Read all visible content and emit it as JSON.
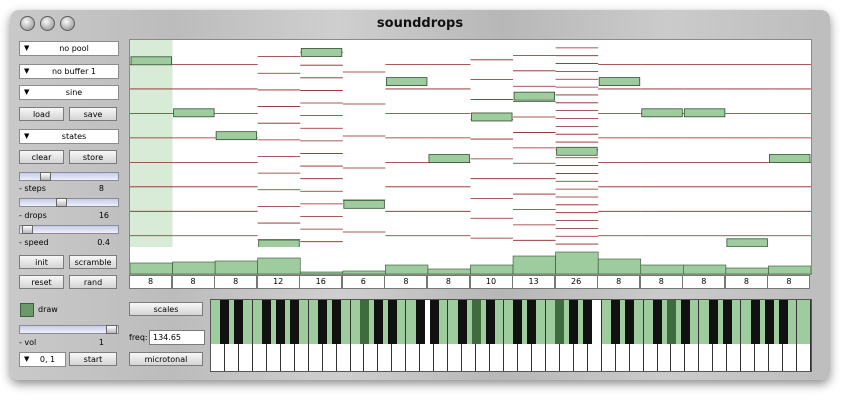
{
  "window": {
    "title": "sounddrops"
  },
  "left": {
    "pool_menu": "no pool",
    "buffer_menu": "no buffer 1",
    "wave_menu": "sine",
    "load": "load",
    "save": "save",
    "states_menu": "states",
    "clear": "clear",
    "store": "store",
    "steps_label": "- steps",
    "steps_value": "8",
    "drops_label": "- drops",
    "drops_value": "16",
    "speed_label": "- speed",
    "speed_value": "0.4",
    "init": "init",
    "scramble": "scramble",
    "reset": "reset",
    "rand": "rand",
    "draw": "draw",
    "vol_label": "- vol",
    "vol_value": "1",
    "pos_menu": "0, 1",
    "start": "start"
  },
  "bottom": {
    "scales": "scales",
    "freq_label": "freq:",
    "freq_value": "134.65",
    "microtonal": "microtonal"
  },
  "colors": {
    "accent_green": "#9fcc9f",
    "line_red": "#8b2323",
    "highlight": "#d8ebd6"
  },
  "columns": [
    {
      "divisions": 8,
      "drop_pos": 0.1
    },
    {
      "divisions": 8,
      "drop_pos": 0.35
    },
    {
      "divisions": 8,
      "drop_pos": 0.46
    },
    {
      "divisions": 12,
      "drop_pos": 0.985
    },
    {
      "divisions": 16,
      "drop_pos": 0.06
    },
    {
      "divisions": 6,
      "drop_pos": 0.79
    },
    {
      "divisions": 8,
      "drop_pos": 0.2
    },
    {
      "divisions": 8,
      "drop_pos": 0.57
    },
    {
      "divisions": 10,
      "drop_pos": 0.37
    },
    {
      "divisions": 13,
      "drop_pos": 0.27
    },
    {
      "divisions": 26,
      "drop_pos": 0.535
    },
    {
      "divisions": 8,
      "drop_pos": 0.2
    },
    {
      "divisions": 8,
      "drop_pos": 0.35
    },
    {
      "divisions": 8,
      "drop_pos": 0.35
    },
    {
      "divisions": 8,
      "drop_pos": 0.975
    },
    {
      "divisions": 8,
      "drop_pos": 0.57
    }
  ],
  "bar_levels": [
    0.4,
    0.45,
    0.47,
    0.6,
    0.08,
    0.1,
    0.35,
    0.2,
    0.35,
    0.68,
    0.82,
    0.55,
    0.35,
    0.33,
    0.22,
    0.3
  ],
  "keyboard": {
    "white_keys": 43,
    "pressed_white": [
      0,
      1,
      2,
      3,
      4,
      5,
      6,
      7,
      8,
      9,
      10,
      11,
      12,
      13,
      14,
      16,
      17,
      18,
      19,
      20,
      21,
      22,
      23,
      24,
      25,
      26,
      28,
      29,
      30,
      31,
      32,
      33,
      34,
      35,
      36,
      37,
      38,
      39,
      40,
      41,
      42
    ],
    "pressed_black": [
      7,
      13,
      17,
      23
    ],
    "white_pressed_tops_only": true
  }
}
